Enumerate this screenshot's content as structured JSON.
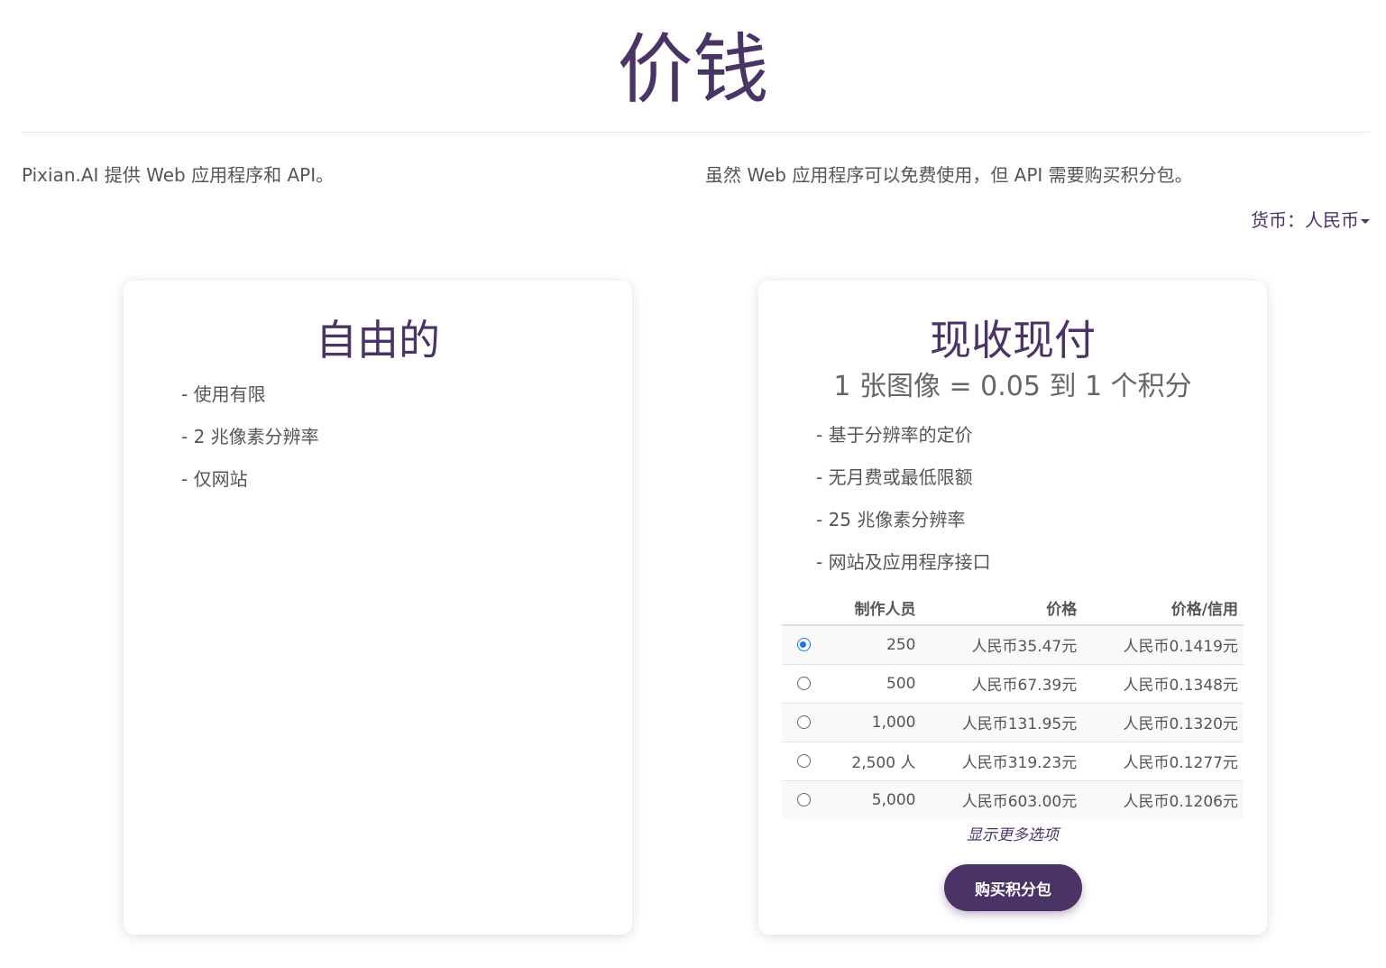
{
  "page": {
    "title": "价钱",
    "intro_left": "Pixian.AI 提供 Web 应用程序和 API。",
    "intro_right": "虽然 Web 应用程序可以免费使用，但 API 需要购买积分包。",
    "currency_label": "货币：人民币"
  },
  "free_plan": {
    "title": "自由的",
    "features": [
      "- 使用有限",
      "- 2 兆像素分辨率",
      "- 仅网站"
    ]
  },
  "paid_plan": {
    "title": "现收现付",
    "subtitle": "1 张图像 = 0.05 到 1 个积分",
    "features": [
      "- 基于分辨率的定价",
      "- 无月费或最低限额",
      "- 25 兆像素分辨率",
      "- 网站及应用程序接口"
    ],
    "table": {
      "headers": [
        "",
        "制作人员",
        "价格",
        "价格/信用"
      ],
      "rows": [
        {
          "selected": true,
          "credits": "250",
          "price": "人民币35.47元",
          "per_credit": "人民币0.1419元"
        },
        {
          "selected": false,
          "credits": "500",
          "price": "人民币67.39元",
          "per_credit": "人民币0.1348元"
        },
        {
          "selected": false,
          "credits": "1,000",
          "price": "人民币131.95元",
          "per_credit": "人民币0.1320元"
        },
        {
          "selected": false,
          "credits": "2,500 人",
          "price": "人民币319.23元",
          "per_credit": "人民币0.1277元"
        },
        {
          "selected": false,
          "credits": "5,000",
          "price": "人民币603.00元",
          "per_credit": "人民币0.1206元"
        }
      ]
    },
    "more_options": "显示更多选项",
    "buy_label": "购买积分包"
  },
  "colors": {
    "brand": "#4a3466",
    "radio_checked": "#1a73e8"
  }
}
